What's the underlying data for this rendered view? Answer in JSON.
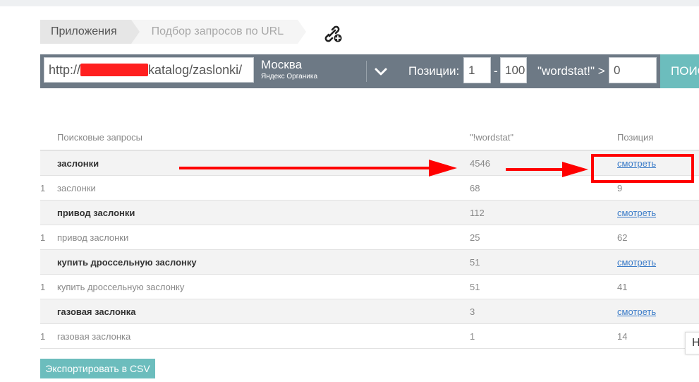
{
  "breadcrumb": {
    "items": [
      {
        "label": "Приложения"
      },
      {
        "label": "Подбор запросов по URL"
      }
    ]
  },
  "toolbar": {
    "url_prefix": "http://",
    "url_suffix": "katalog/zaslonki/",
    "region_city": "Москва",
    "region_engine": "Яндекс Органика",
    "positions_label": "Позиции:",
    "positions_from": "1",
    "positions_dash": "-",
    "positions_to": "100",
    "wordstat_label": "\"wordstat!\" >",
    "wordstat_value": "0",
    "search_label": "ПОИСК"
  },
  "table": {
    "headers": {
      "query": "Поисковые запросы",
      "wordstat": "\"!wordstat\"",
      "position": "Позиция"
    },
    "rows": [
      {
        "type": "main",
        "num": "",
        "query": "заслонки",
        "wordstat": "4546",
        "position": "смотреть"
      },
      {
        "type": "sub",
        "num": "1",
        "query": "заслонки",
        "wordstat": "68",
        "position": "9"
      },
      {
        "type": "main",
        "num": "",
        "query": "привод заслонки",
        "wordstat": "112",
        "position": "смотреть"
      },
      {
        "type": "sub",
        "num": "1",
        "query": "привод заслонки",
        "wordstat": "25",
        "position": "62"
      },
      {
        "type": "main",
        "num": "",
        "query": "купить дроссельную заслонку",
        "wordstat": "51",
        "position": "смотреть"
      },
      {
        "type": "sub",
        "num": "1",
        "query": "купить дроссельную заслонку",
        "wordstat": "51",
        "position": "41"
      },
      {
        "type": "main",
        "num": "",
        "query": "газовая заслонка",
        "wordstat": "3",
        "position": "смотреть"
      },
      {
        "type": "sub",
        "num": "1",
        "query": "газовая заслонка",
        "wordstat": "1",
        "position": "14"
      }
    ]
  },
  "export_label": "Экспортировать в CSV",
  "side_tab_label": "Н",
  "icons": {
    "add_link": "link-plus-icon",
    "dropdown": "chevron-down-icon"
  },
  "colors": {
    "toolbar_bg": "#6d7985",
    "accent": "#6cbdbd",
    "annotation": "#ff0000",
    "link": "#3a7bc8",
    "redaction": "#ff1f1f"
  }
}
